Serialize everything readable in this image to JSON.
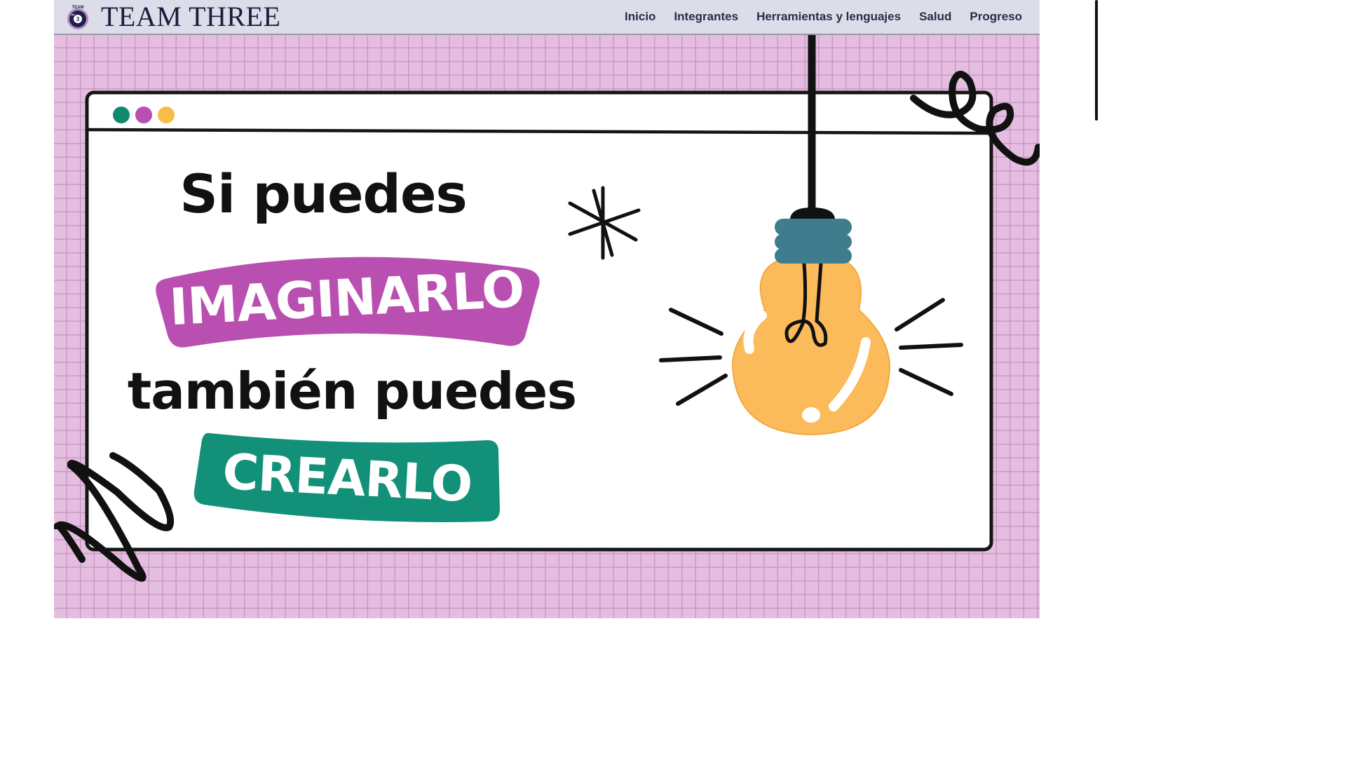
{
  "brand": {
    "title": "TEAM THREE",
    "logo_icon": "eight-ball-logo-icon",
    "logo_text": "TEAM"
  },
  "nav": {
    "items": [
      {
        "label": "Inicio"
      },
      {
        "label": "Integrantes"
      },
      {
        "label": "Herramientas y lenguajes"
      },
      {
        "label": "Salud"
      },
      {
        "label": "Progreso"
      }
    ]
  },
  "hero": {
    "line1": "Si puedes",
    "line2": "IMAGINARLO",
    "line3": "también puedes",
    "line4": "CREARLO",
    "illustration_icon": "lightbulb-icon",
    "colors": {
      "background": "#e5bde0",
      "grid": "#c99ac3",
      "purple": "#b94fb0",
      "green": "#129078",
      "yellow": "#fcbb5a",
      "teal": "#3f7d8e",
      "dot_green": "#0f8a6f",
      "dot_purple": "#b94fb0",
      "dot_yellow": "#f8bd48"
    }
  }
}
